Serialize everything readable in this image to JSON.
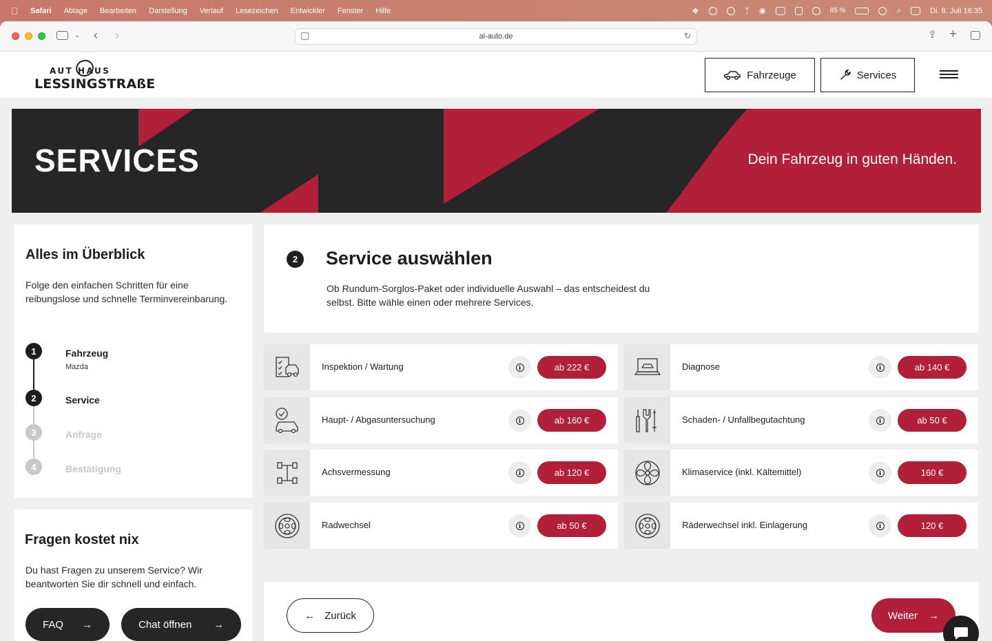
{
  "menubar": {
    "app": "Safari",
    "items": [
      "Ablage",
      "Bearbeiten",
      "Darstellung",
      "Verlauf",
      "Lesezeichen",
      "Entwickler",
      "Fenster",
      "Hilfe"
    ],
    "battery": "85 %",
    "datetime": "Di. 8. Juli  16:35"
  },
  "browser": {
    "url": "al-auto.de"
  },
  "header": {
    "logo_top": "AUT HAUS",
    "logo_bottom": "LESSINGSTRAßE",
    "nav_vehicles": "Fahrzeuge",
    "nav_services": "Services"
  },
  "hero": {
    "title": "SERVICES",
    "subtitle": "Dein Fahrzeug in guten Händen."
  },
  "overview": {
    "title": "Alles im Überblick",
    "text": "Folge den einfachen Schritten für eine reibungslose und schnelle Terminvereinbarung.",
    "steps": [
      {
        "num": "1",
        "label": "Fahrzeug",
        "sub": "Mazda",
        "state": "done"
      },
      {
        "num": "2",
        "label": "Service",
        "sub": "",
        "state": "active"
      },
      {
        "num": "3",
        "label": "Anfrage",
        "sub": "",
        "state": "pending"
      },
      {
        "num": "4",
        "label": "Bestätigung",
        "sub": "",
        "state": "pending"
      }
    ]
  },
  "faq": {
    "title": "Fragen kostet nix",
    "text": "Du hast Fragen zu unserem Service? Wir beantworten Sie dir schnell und einfach.",
    "faq_button": "FAQ",
    "chat_button": "Chat öffnen"
  },
  "main": {
    "step_num": "2",
    "title": "Service auswählen",
    "text": "Ob Rundum-Sorglos-Paket oder individuelle Auswahl – das entscheidest du selbst. Bitte wähle einen oder mehrere Services."
  },
  "services": [
    {
      "name": "Inspektion / Wartung",
      "price": "ab 222 €",
      "icon": "checklist-car-icon"
    },
    {
      "name": "Diagnose",
      "price": "ab 140 €",
      "icon": "laptop-car-icon"
    },
    {
      "name": "Haupt- / Abgasuntersuchung",
      "price": "ab 160 €",
      "icon": "car-check-icon"
    },
    {
      "name": "Schaden- / Unfallbegutachtung",
      "price": "ab 50 €",
      "icon": "tools-icon"
    },
    {
      "name": "Achsvermessung",
      "price": "ab 120 €",
      "icon": "axle-icon"
    },
    {
      "name": "Klimaservice (inkl. Kältemittel)",
      "price": "160 €",
      "icon": "fan-icon"
    },
    {
      "name": "Radwechsel",
      "price": "ab 50 €",
      "icon": "wheel-icon"
    },
    {
      "name": "Räderwechsel inkl. Einlagerung",
      "price": "120 €",
      "icon": "wheel-icon"
    }
  ],
  "nav_buttons": {
    "back": "Zurück",
    "next": "Weiter"
  },
  "colors": {
    "brand_red": "#b21f39",
    "dark": "#262626"
  }
}
